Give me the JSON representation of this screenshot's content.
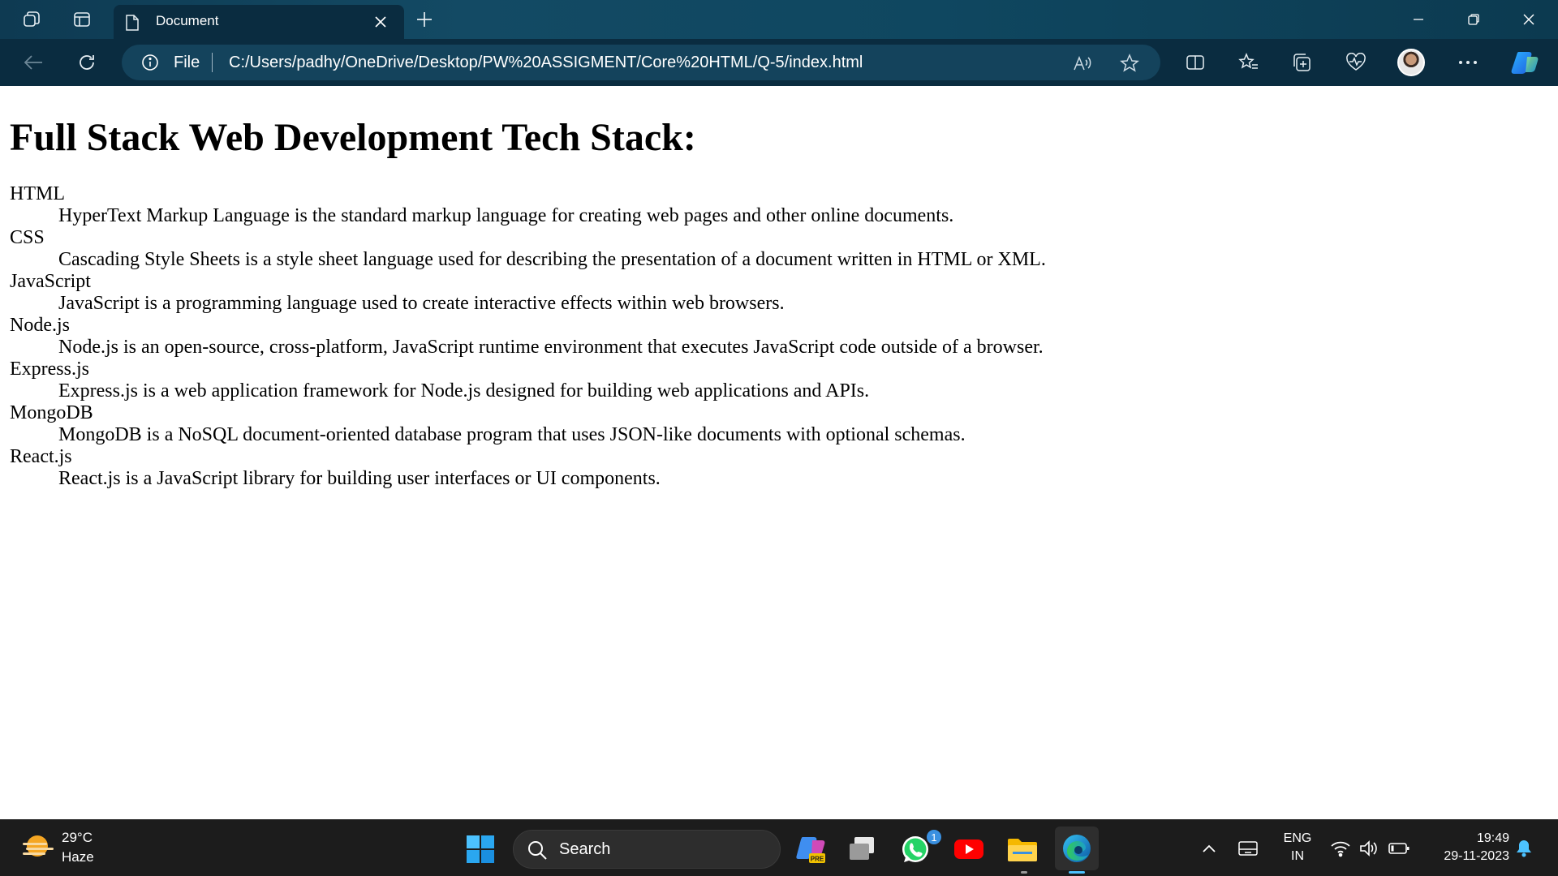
{
  "browser": {
    "tab_title": "Document",
    "address_scheme": "File",
    "address_url": "C:/Users/padhy/OneDrive/Desktop/PW%20ASSIGMENT/Core%20HTML/Q-5/index.html",
    "icons": [
      "workspaces-icon",
      "vertical-tabs-icon",
      "document-icon",
      "close-icon",
      "new-tab-icon",
      "minimize-icon",
      "restore-icon",
      "window-close-icon",
      "back-icon",
      "refresh-icon",
      "info-icon",
      "read-aloud-icon",
      "favorite-star-icon",
      "split-screen-icon",
      "favorites-icon",
      "collections-icon",
      "browser-essentials-icon",
      "profile-avatar",
      "more-icon",
      "copilot-icon"
    ]
  },
  "page": {
    "heading": "Full Stack Web Development Tech Stack:",
    "definitions": [
      {
        "term": "HTML",
        "description": "HyperText Markup Language is the standard markup language for creating web pages and other online documents."
      },
      {
        "term": "CSS",
        "description": "Cascading Style Sheets is a style sheet language used for describing the presentation of a document written in HTML or XML."
      },
      {
        "term": "JavaScript",
        "description": "JavaScript is a programming language used to create interactive effects within web browsers."
      },
      {
        "term": "Node.js",
        "description": "Node.js is an open-source, cross-platform, JavaScript runtime environment that executes JavaScript code outside of a browser."
      },
      {
        "term": "Express.js",
        "description": "Express.js is a web application framework for Node.js designed for building web applications and APIs."
      },
      {
        "term": "MongoDB",
        "description": "MongoDB is a NoSQL document-oriented database program that uses JSON-like documents with optional schemas."
      },
      {
        "term": "React.js",
        "description": "React.js is a JavaScript library for building user interfaces or UI components."
      }
    ]
  },
  "taskbar": {
    "weather_temp": "29°C",
    "weather_desc": "Haze",
    "search_placeholder": "Search",
    "whatsapp_badge": "1",
    "copilot_badge": "PRE",
    "lang_primary": "ENG",
    "lang_secondary": "IN",
    "time": "19:49",
    "date": "29-11-2023"
  },
  "colors": {
    "chrome_dark": "#0a2c40",
    "address_bar": "#14435c",
    "taskbar_bg": "#1c1c1c",
    "accent": "#4cc2ff"
  }
}
